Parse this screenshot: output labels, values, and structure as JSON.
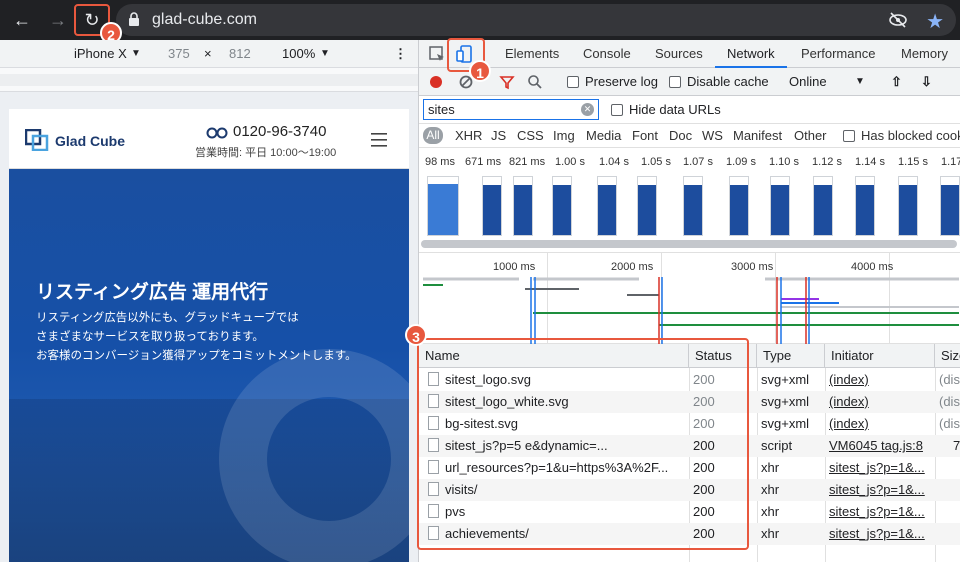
{
  "browser": {
    "url": "glad-cube.com"
  },
  "callouts": [
    "1",
    "2",
    "3"
  ],
  "device_toolbar": {
    "device": "iPhone X",
    "width": "375",
    "times": "×",
    "height": "812",
    "zoom": "100%"
  },
  "site": {
    "logo_text": "Glad Cube",
    "phone": "0120-96-3740",
    "hours": "営業時間: 平日 10:00〜19:00",
    "hero_title": "リスティング広告 運用代行",
    "hero_lines": [
      "リスティング広告以外にも、グラッドキューブでは",
      "さまざまなサービスを取り扱っております。",
      "お客様のコンバージョン獲得アップをコミットメントします。"
    ]
  },
  "devtools": {
    "tabs": [
      "Elements",
      "Console",
      "Sources",
      "Network",
      "Performance",
      "Memory"
    ],
    "active_tab": "Network",
    "toolbar": {
      "preserve_log": "Preserve log",
      "disable_cache": "Disable cache",
      "throttle": "Online"
    },
    "filter": {
      "value": "sites",
      "hide_data_urls": "Hide data URLs"
    },
    "types": [
      "All",
      "XHR",
      "JS",
      "CSS",
      "Img",
      "Media",
      "Font",
      "Doc",
      "WS",
      "Manifest",
      "Other"
    ],
    "blocked": "Has blocked cookies",
    "filmstrip_times": [
      "98 ms",
      "671 ms",
      "821 ms",
      "1.00 s",
      "1.04 s",
      "1.05 s",
      "1.07 s",
      "1.09 s",
      "1.10 s",
      "1.12 s",
      "1.14 s",
      "1.15 s",
      "1.17"
    ],
    "overview_labels": [
      "1000 ms",
      "2000 ms",
      "3000 ms",
      "4000 ms"
    ],
    "table": {
      "headers": [
        "Name",
        "Status",
        "Type",
        "Initiator",
        "Size"
      ],
      "rows": [
        {
          "name": "sitest_logo.svg",
          "status": "200",
          "type": "svg+xml",
          "initiator": "(index)",
          "size": "(dis"
        },
        {
          "name": "sitest_logo_white.svg",
          "status": "200",
          "type": "svg+xml",
          "initiator": "(index)",
          "size": "(dis"
        },
        {
          "name": "bg-sitest.svg",
          "status": "200",
          "type": "svg+xml",
          "initiator": "(index)",
          "size": "(dis"
        },
        {
          "name": "sitest_js?p=5          e&dynamic=...",
          "status": "200",
          "type": "script",
          "initiator": "VM6045 tag.js:8",
          "size": "7"
        },
        {
          "name": "url_resources?p=1&u=https%3A%2F...",
          "status": "200",
          "type": "xhr",
          "initiator": "sitest_js?p=1&...",
          "size": ""
        },
        {
          "name": "visits/",
          "status": "200",
          "type": "xhr",
          "initiator": "sitest_js?p=1&...",
          "size": ""
        },
        {
          "name": "pvs",
          "status": "200",
          "type": "xhr",
          "initiator": "sitest_js?p=1&...",
          "size": ""
        },
        {
          "name": "achievements/",
          "status": "200",
          "type": "xhr",
          "initiator": "sitest_js?p=1&...",
          "size": ""
        }
      ]
    }
  },
  "colors": {
    "accent": "#1a73e8",
    "callout": "#e8583e",
    "hero": "#1a4fa0"
  }
}
